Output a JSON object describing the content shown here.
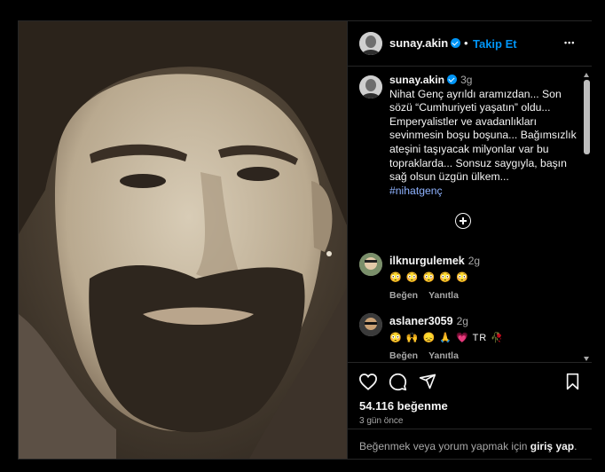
{
  "header": {
    "username": "sunay.akin",
    "separator": "•",
    "follow_label": "Takip Et",
    "more_label": "•••"
  },
  "caption": {
    "username": "sunay.akin",
    "time": "3g",
    "text": "Nihat Genç ayrıldı aramızdan... Son sözü “Cumhuriyeti yaşatın” oldu... Emperyalistler ve avadanlıkları sevinmesin boşu boşuna... Bağımsızlık ateşini taşıyacak milyonlar var bu topraklarda... Sonsuz saygıyla, başın sağ olsun üzgün ülkem...",
    "hashtag": "#nihatgenç"
  },
  "comments": [
    {
      "username": "ilknurgulemek",
      "time": "2g",
      "emojis": "😳 😳 😳 😳 😳",
      "like_label": "Beğen",
      "reply_label": "Yanıtla"
    },
    {
      "username": "aslaner3059",
      "time": "2g",
      "emojis": "😳 🙌 😞 🙏 💗 TR 🥀",
      "like_label": "Beğen",
      "reply_label": "Yanıtla"
    }
  ],
  "footer": {
    "likes": "54.116 beğenme",
    "ago": "3 gün önce",
    "login_prefix": "Beğenmek veya yorum yapmak için",
    "login_link": "giriş yap",
    "login_suffix": "."
  },
  "colors": {
    "background": "#000000",
    "accent": "#0095f6",
    "muted": "#a8a8a8",
    "text": "#f5f5f5"
  },
  "icons": [
    "verified-badge-icon",
    "more-options-icon",
    "add-comment-plus-icon",
    "heart-icon",
    "comment-icon",
    "share-icon",
    "bookmark-icon"
  ]
}
